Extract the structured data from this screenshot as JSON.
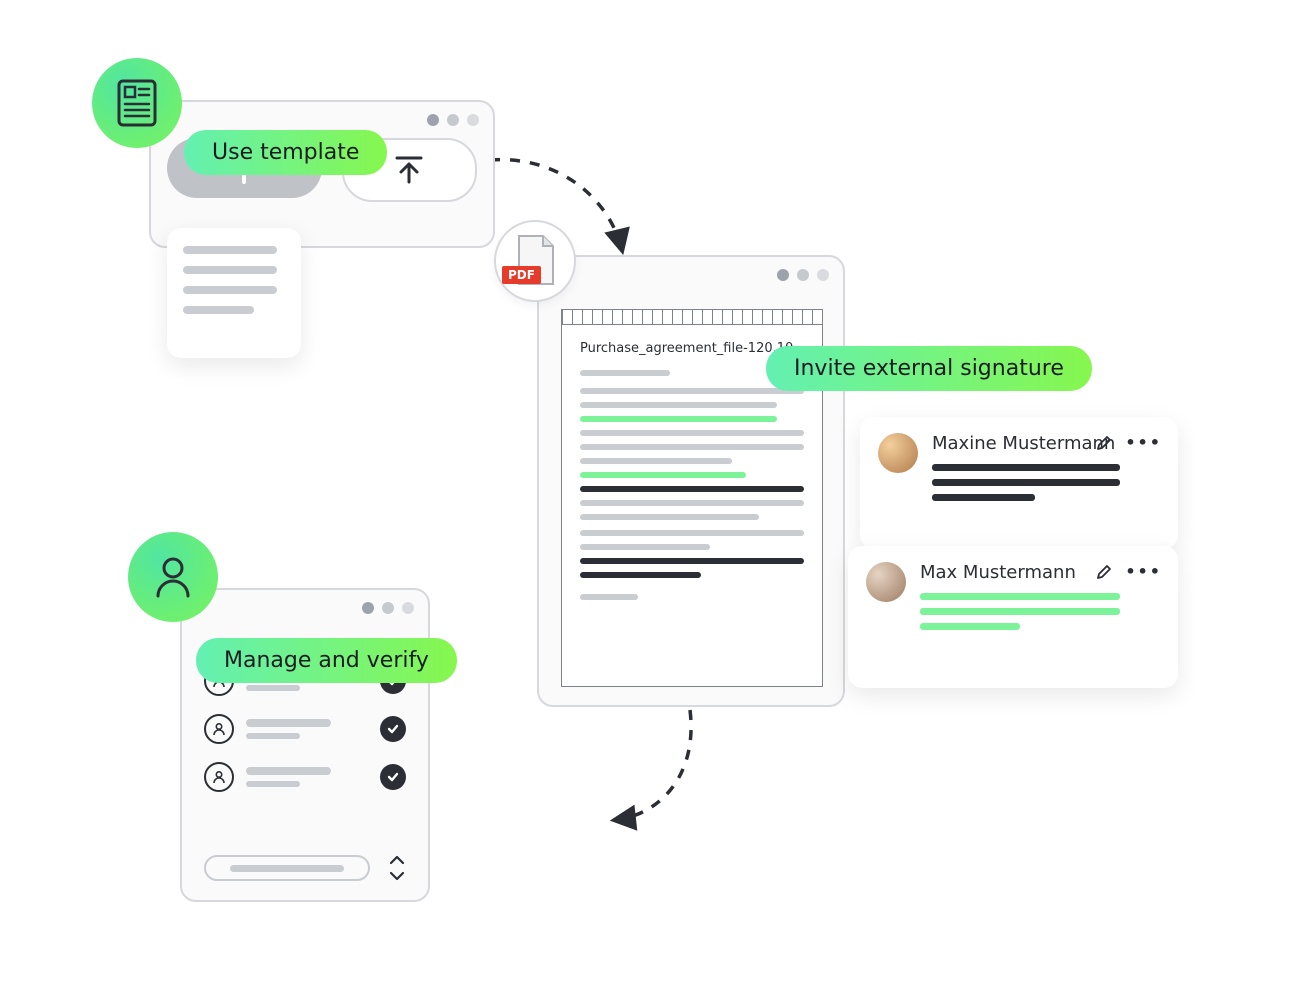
{
  "labels": {
    "use_template": "Use template",
    "invite_external": "Invite external signature",
    "manage_verify": "Manage and verify",
    "pdf_badge": "PDF"
  },
  "document": {
    "filename": "Purchase_agreement_file-120.10"
  },
  "signers": [
    {
      "name": "Maxine Mustermann"
    },
    {
      "name": "Max Mustermann"
    }
  ]
}
